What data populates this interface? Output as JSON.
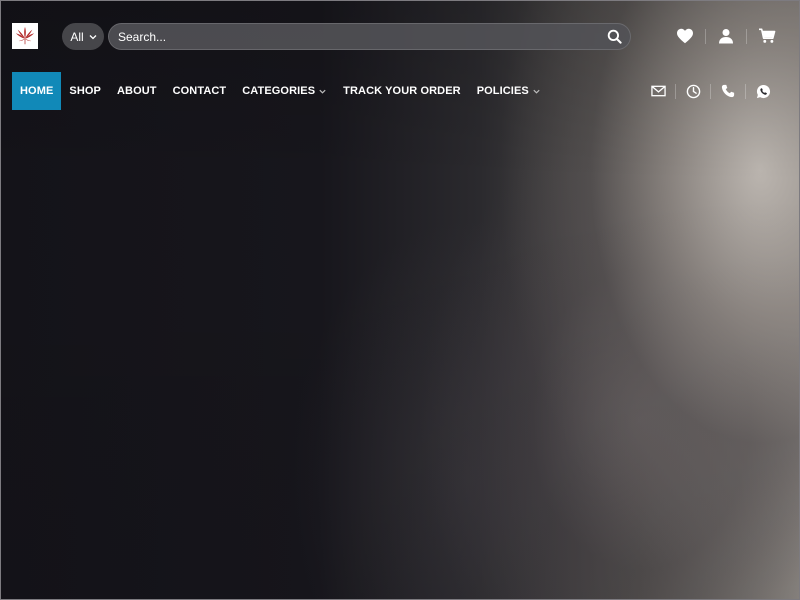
{
  "header": {
    "logo": {
      "icon": "cannabis-leaf-icon"
    },
    "search": {
      "category_label": "All",
      "placeholder": "Search...",
      "value": ""
    },
    "icons": {
      "wishlist": "heart-icon",
      "account": "user-icon",
      "cart": "cart-icon"
    }
  },
  "nav": {
    "items": [
      {
        "label": "HOME",
        "active": true
      },
      {
        "label": "SHOP"
      },
      {
        "label": "ABOUT"
      },
      {
        "label": "CONTACT"
      },
      {
        "label": "CATEGORIES",
        "dropdown": true
      },
      {
        "label": "TRACK YOUR ORDER"
      },
      {
        "label": "POLICIES",
        "dropdown": true
      }
    ]
  },
  "contact_icons": [
    "envelope-icon",
    "clock-icon",
    "phone-icon",
    "whatsapp-icon"
  ],
  "colors": {
    "accent": "#1189b8",
    "logo_leaf": "#b22a2a"
  }
}
